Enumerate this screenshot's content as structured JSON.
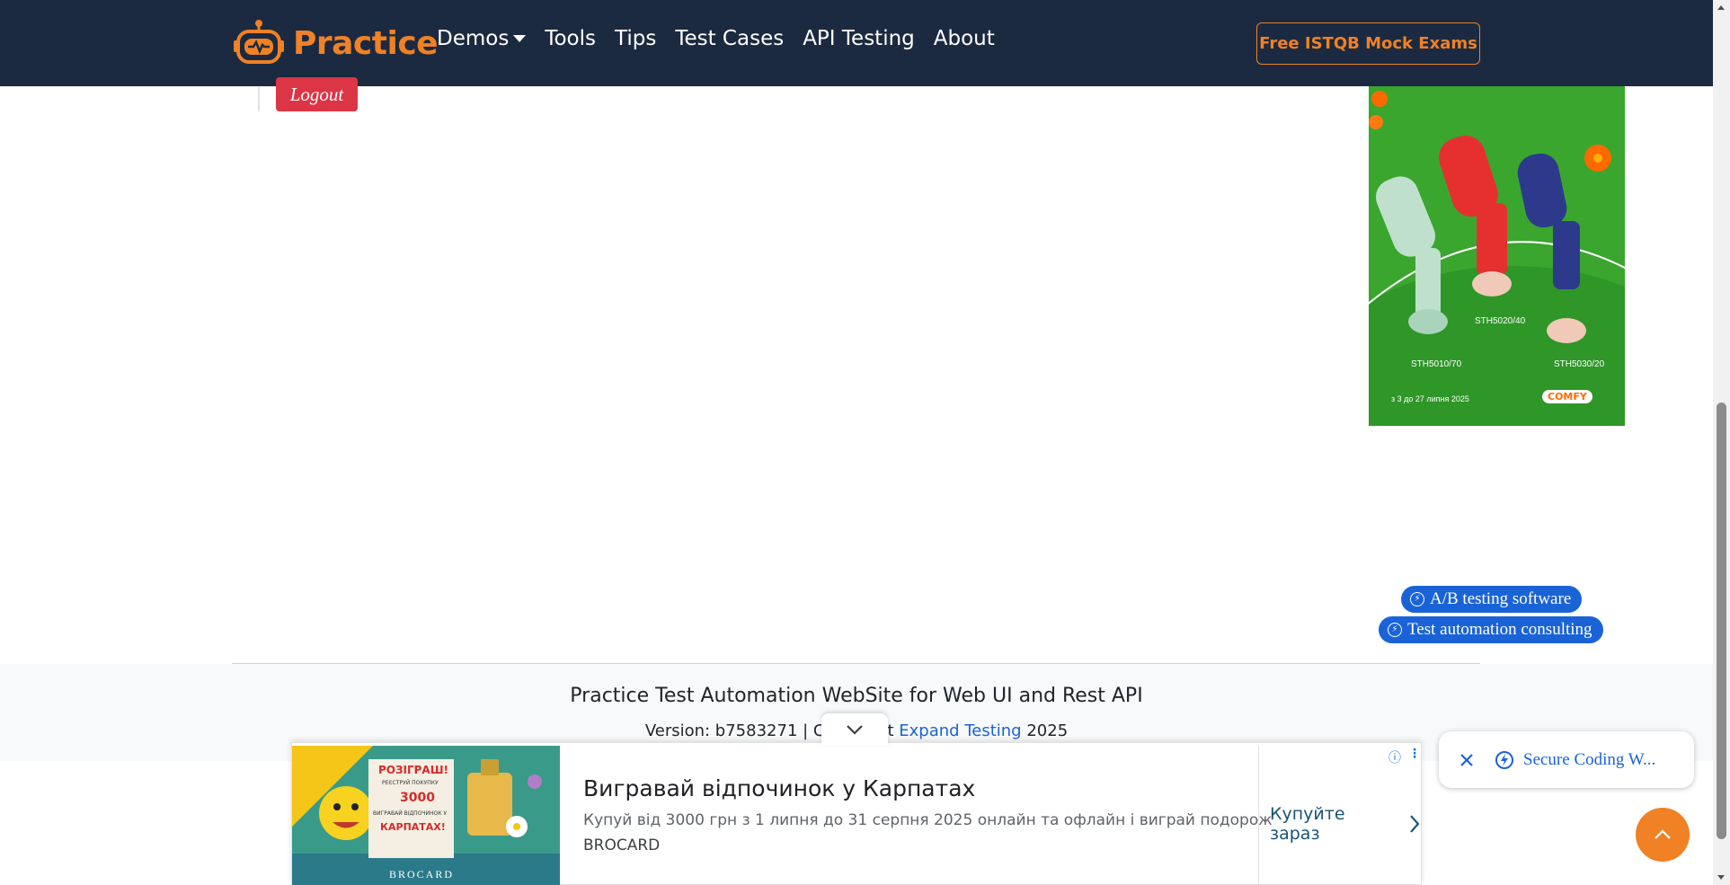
{
  "navbar": {
    "brand": "Practice",
    "items": [
      "Demos",
      "Tools",
      "Tips",
      "Test Cases",
      "API Testing",
      "About"
    ],
    "cta": "Free ISTQB Mock Exams",
    "colors": {
      "background": "#1b2a40",
      "accent": "#f08125"
    }
  },
  "content": {
    "logout_label": "Logout"
  },
  "side_ad": {
    "models": [
      "STH5020/40",
      "STH5010/70",
      "STH5030/20"
    ],
    "date_text": "з 3 до 27 липня 2025",
    "brand": "COMFY"
  },
  "pills": {
    "ab_testing": "A/B testing software",
    "automation_consulting": "Test automation consulting"
  },
  "footer": {
    "title": "Practice Test Automation WebSite for Web UI and Rest API",
    "version_prefix": "Version: b7583271 | C",
    "version_hidden_suffix": "t",
    "link_text": "Expand Testing",
    "year": "2025"
  },
  "bottom_ad": {
    "image_texts": [
      "РОЗІГРАШ!",
      "РЕЄСТРУЙ ПОКУПКУ",
      "3000",
      "ВИГРАВАЙ ВІДПОЧИНОК У",
      "КАРПАТАХ!",
      "BROCARD"
    ],
    "headline": "Вигравай відпочинок у Карпатах",
    "description": "Купуй від 3000 грн з 1 липня до 31 серпня 2025 онлайн та офлайн і виграй подорож",
    "advertiser": "BROCARD",
    "cta": "Купуйте зараз"
  },
  "chip": {
    "label": "Secure Coding W..."
  }
}
